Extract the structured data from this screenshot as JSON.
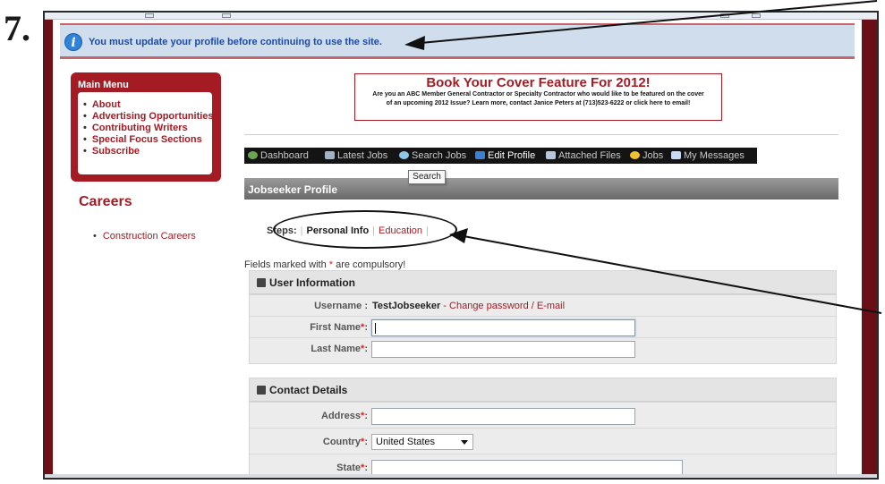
{
  "step_number": "7.",
  "notice": {
    "text": "You must update your profile before continuing to use the site."
  },
  "main_menu": {
    "title": "Main Menu",
    "items": [
      "About",
      "Advertising Opportunities",
      "Contributing Writers",
      "Special Focus Sections",
      "Subscribe"
    ]
  },
  "careers": {
    "title": "Careers",
    "items": [
      "Construction Careers"
    ]
  },
  "promo": {
    "title": "Book Your Cover Feature For 2012!",
    "text": "Are you an ABC Member General Contractor or Specialty Contractor who would like to be featured on the cover of an upcoming 2012 Issue?  Learn more, contact Janice Peters at (713)523-6222 or click here to email!"
  },
  "nav": {
    "items": [
      {
        "label": "Dashboard",
        "icon": "dashboard-icon",
        "color": "#6aa84f"
      },
      {
        "label": "Latest Jobs",
        "icon": "latest-jobs-icon",
        "color": "#9fb4c8"
      },
      {
        "label": "Search Jobs",
        "icon": "search-icon",
        "color": "#8ec6e8"
      },
      {
        "label": "Edit Profile",
        "icon": "edit-profile-icon",
        "color": "#3d7fd1"
      },
      {
        "label": "Attached Files",
        "icon": "attached-files-icon",
        "color": "#b7c7d8"
      },
      {
        "label": "Jobs",
        "icon": "jobs-icon",
        "color": "#f1c232"
      },
      {
        "label": "My Messages",
        "icon": "messages-icon",
        "color": "#c9daf8"
      }
    ],
    "active_index": 3,
    "tooltip": "Search"
  },
  "profile_header": "Jobseeker Profile",
  "steps": {
    "label": "Steps:",
    "items": [
      "Personal Info",
      "Education"
    ]
  },
  "compulsory": {
    "text_before": "Fields marked with ",
    "star": "*",
    "text_after": " are compulsory!"
  },
  "user_info": {
    "title": "User Information",
    "username_label": "Username :",
    "username_value": "TestJobseeker",
    "username_sep": " - ",
    "change_link": "Change password / E-mail",
    "first_name_label": "First Name",
    "first_name_value": "",
    "last_name_label": "Last Name",
    "last_name_value": ""
  },
  "contact": {
    "title": "Contact Details",
    "address_label": "Address",
    "address_value": "",
    "country_label": "Country",
    "country_value": "United States",
    "state_label": "State",
    "state_value": ""
  },
  "required_mark": "*",
  "colors": {
    "accent": "#a51b23",
    "notice_bg": "#cfddec",
    "notice_text": "#1c4aa6",
    "sidebar": "#6e1016"
  }
}
